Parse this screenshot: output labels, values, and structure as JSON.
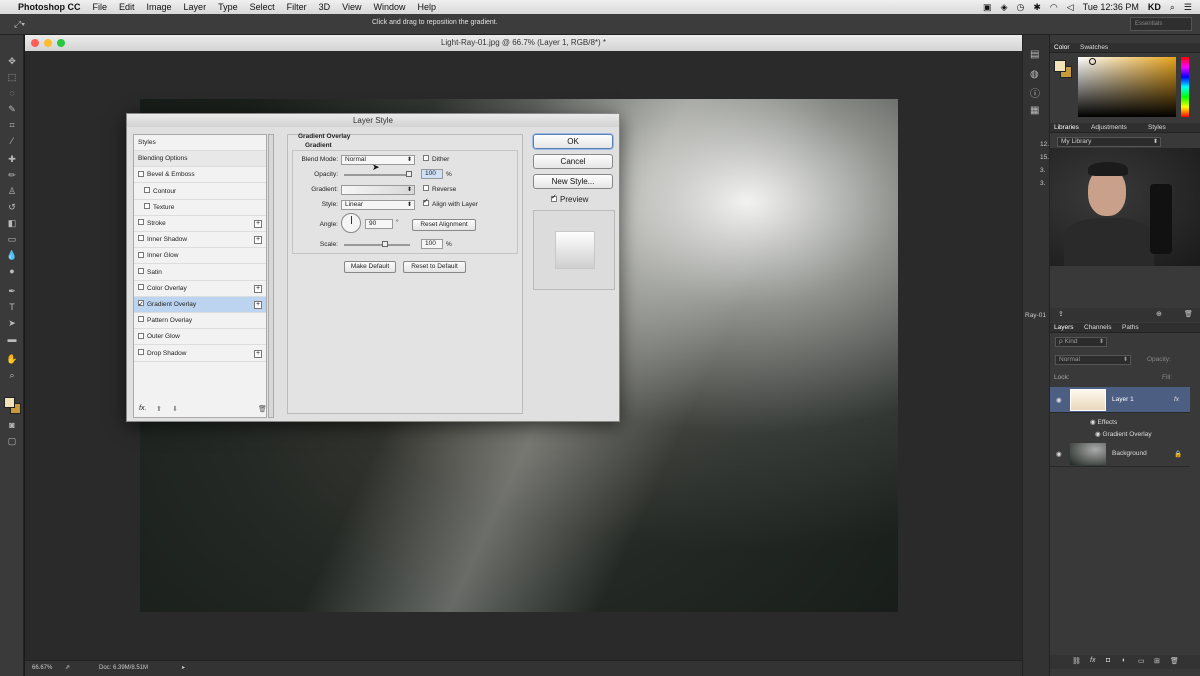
{
  "menubar": {
    "app": "Photoshop CC",
    "items": [
      "File",
      "Edit",
      "Image",
      "Layer",
      "Type",
      "Select",
      "Filter",
      "3D",
      "View",
      "Window",
      "Help"
    ],
    "clock": "Tue 12:36 PM",
    "user": "KD"
  },
  "optbar": {
    "hint": "Click and drag to reposition the gradient.",
    "workspace": "Essentials"
  },
  "document": {
    "title": "Light-Ray-01.jpg @ 66.7% (Layer 1, RGB/8*) *",
    "zoom": "66.67%",
    "doc_size": "Doc: 6.39M/8.51M"
  },
  "dialog": {
    "title": "Layer Style",
    "styles": [
      {
        "label": "Styles",
        "checkbox": false,
        "checked": false,
        "plus": false,
        "indent": 0
      },
      {
        "label": "Blending Options",
        "checkbox": false,
        "checked": false,
        "plus": false,
        "indent": 0
      },
      {
        "label": "Bevel & Emboss",
        "checkbox": true,
        "checked": false,
        "plus": false,
        "indent": 0
      },
      {
        "label": "Contour",
        "checkbox": true,
        "checked": false,
        "plus": false,
        "indent": 1
      },
      {
        "label": "Texture",
        "checkbox": true,
        "checked": false,
        "plus": false,
        "indent": 1
      },
      {
        "label": "Stroke",
        "checkbox": true,
        "checked": false,
        "plus": true,
        "indent": 0
      },
      {
        "label": "Inner Shadow",
        "checkbox": true,
        "checked": false,
        "plus": true,
        "indent": 0
      },
      {
        "label": "Inner Glow",
        "checkbox": true,
        "checked": false,
        "plus": false,
        "indent": 0
      },
      {
        "label": "Satin",
        "checkbox": true,
        "checked": false,
        "plus": false,
        "indent": 0
      },
      {
        "label": "Color Overlay",
        "checkbox": true,
        "checked": false,
        "plus": true,
        "indent": 0
      },
      {
        "label": "Gradient Overlay",
        "checkbox": true,
        "checked": true,
        "plus": true,
        "indent": 0
      },
      {
        "label": "Pattern Overlay",
        "checkbox": true,
        "checked": false,
        "plus": false,
        "indent": 0
      },
      {
        "label": "Outer Glow",
        "checkbox": true,
        "checked": false,
        "plus": false,
        "indent": 0
      },
      {
        "label": "Drop Shadow",
        "checkbox": true,
        "checked": false,
        "plus": true,
        "indent": 0
      }
    ],
    "section_title": "Gradient Overlay",
    "section_sub": "Gradient",
    "blend_mode_label": "Blend Mode:",
    "blend_mode": "Normal",
    "dither_label": "Dither",
    "opacity_label": "Opacity:",
    "opacity": "100",
    "pct": "%",
    "gradient_label": "Gradient:",
    "reverse_label": "Reverse",
    "style_label": "Style:",
    "style": "Linear",
    "align_label": "Align with Layer",
    "angle_label": "Angle:",
    "angle": "90",
    "deg": "°",
    "reset_align": "Reset Alignment",
    "scale_label": "Scale:",
    "scale": "100",
    "make_default": "Make Default",
    "reset_default": "Reset to Default",
    "ok": "OK",
    "cancel": "Cancel",
    "new_style": "New Style...",
    "preview": "Preview",
    "fx": "fx."
  },
  "panels": {
    "color_tabs": [
      "Color",
      "Swatches"
    ],
    "lib_tabs": [
      "Libraries",
      "Adjustments",
      "Styles"
    ],
    "library": "My Library",
    "layer_tabs": [
      "Layers",
      "Channels",
      "Paths"
    ],
    "kind": "ρ Kind",
    "blend": "Normal",
    "opacity_label": "Opacity:",
    "lock_label": "Lock:",
    "fill_label": "Fill:",
    "layers": {
      "layer1": "Layer 1",
      "effects": "Effects",
      "gradient_overlay": "Gradient Overlay",
      "background": "Background"
    },
    "side_numbers": [
      "12.",
      "15.",
      "3.",
      "3."
    ],
    "sidebar_frag": "Ray-01"
  },
  "colors": {
    "accent": "#bcd4ef",
    "foreground": "#f2e2b8",
    "background": "#c89a3a"
  }
}
